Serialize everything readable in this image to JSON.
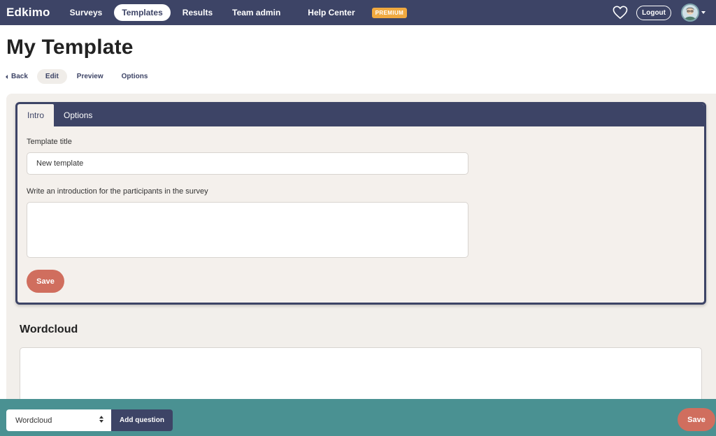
{
  "topnav": {
    "brand": "Edkimo",
    "items": [
      {
        "label": "Surveys",
        "active": false
      },
      {
        "label": "Templates",
        "active": true
      },
      {
        "label": "Results",
        "active": false
      },
      {
        "label": "Team admin",
        "active": false
      },
      {
        "label": "Help Center",
        "active": false
      }
    ],
    "premium_badge": "PREMIUM",
    "logout_label": "Logout",
    "heart_icon": "heart-icon",
    "avatar_icon": "user-avatar"
  },
  "page": {
    "title": "My Template",
    "subnav": {
      "back_label": "Back",
      "tabs": [
        {
          "label": "Edit",
          "active": true
        },
        {
          "label": "Preview",
          "active": false
        },
        {
          "label": "Options",
          "active": false
        }
      ]
    }
  },
  "card": {
    "tabs": [
      {
        "label": "Intro",
        "active": true
      },
      {
        "label": "Options",
        "active": false
      }
    ],
    "title_label": "Template title",
    "title_value": "New template",
    "intro_label": "Write an introduction for the participants in the survey",
    "intro_value": "",
    "save_label": "Save"
  },
  "question": {
    "title": "Wordcloud"
  },
  "bottombar": {
    "question_type": "Wordcloud",
    "add_question_label": "Add question",
    "save_label": "Save"
  },
  "colors": {
    "nav": "#3d4466",
    "premium": "#f0a940",
    "save": "#d06e5e",
    "bottombar": "#4a9192",
    "content_bg": "#f2efeb"
  }
}
